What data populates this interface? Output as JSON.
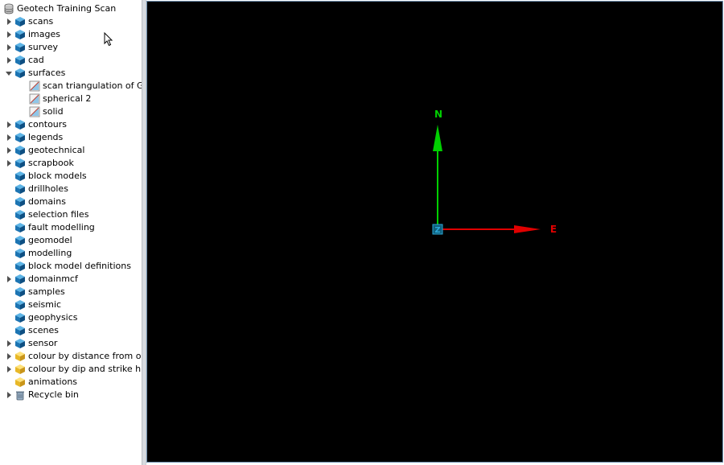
{
  "tree": {
    "root_label": "Geotech Training Scan",
    "items": [
      {
        "label": "scans",
        "icon": "blue-cube-icon",
        "arrow": "collapsed",
        "level": 0
      },
      {
        "label": "images",
        "icon": "blue-cube-icon",
        "arrow": "collapsed",
        "level": 0
      },
      {
        "label": "survey",
        "icon": "blue-cube-icon",
        "arrow": "collapsed",
        "level": 0
      },
      {
        "label": "cad",
        "icon": "blue-cube-icon",
        "arrow": "collapsed",
        "level": 0
      },
      {
        "label": "surfaces",
        "icon": "blue-cube-icon",
        "arrow": "expanded",
        "level": 0
      },
      {
        "label": "scan triangulation of G...",
        "icon": "surface-icon",
        "arrow": "none",
        "level": 1
      },
      {
        "label": "spherical 2",
        "icon": "surface-icon",
        "arrow": "none",
        "level": 1
      },
      {
        "label": "solid",
        "icon": "surface-icon",
        "arrow": "none",
        "level": 1
      },
      {
        "label": "contours",
        "icon": "blue-cube-icon",
        "arrow": "collapsed",
        "level": 0
      },
      {
        "label": "legends",
        "icon": "blue-cube-icon",
        "arrow": "collapsed",
        "level": 0
      },
      {
        "label": "geotechnical",
        "icon": "blue-cube-icon",
        "arrow": "collapsed",
        "level": 0
      },
      {
        "label": "scrapbook",
        "icon": "blue-cube-icon",
        "arrow": "collapsed",
        "level": 0
      },
      {
        "label": "block models",
        "icon": "blue-cube-icon",
        "arrow": "none",
        "level": 0
      },
      {
        "label": "drillholes",
        "icon": "blue-cube-icon",
        "arrow": "none",
        "level": 0
      },
      {
        "label": "domains",
        "icon": "blue-cube-icon",
        "arrow": "none",
        "level": 0
      },
      {
        "label": "selection files",
        "icon": "blue-cube-icon",
        "arrow": "none",
        "level": 0
      },
      {
        "label": "fault modelling",
        "icon": "blue-cube-icon",
        "arrow": "none",
        "level": 0
      },
      {
        "label": "geomodel",
        "icon": "blue-cube-icon",
        "arrow": "none",
        "level": 0
      },
      {
        "label": "modelling",
        "icon": "blue-cube-icon",
        "arrow": "none",
        "level": 0
      },
      {
        "label": "block model definitions",
        "icon": "blue-cube-icon",
        "arrow": "none",
        "level": 0
      },
      {
        "label": "domainmcf",
        "icon": "blue-cube-icon",
        "arrow": "collapsed",
        "level": 0
      },
      {
        "label": "samples",
        "icon": "blue-cube-icon",
        "arrow": "none",
        "level": 0
      },
      {
        "label": "seismic",
        "icon": "blue-cube-icon",
        "arrow": "none",
        "level": 0
      },
      {
        "label": "geophysics",
        "icon": "blue-cube-icon",
        "arrow": "none",
        "level": 0
      },
      {
        "label": "scenes",
        "icon": "blue-cube-icon",
        "arrow": "none",
        "level": 0
      },
      {
        "label": "sensor",
        "icon": "blue-cube-icon",
        "arrow": "collapsed",
        "level": 0
      },
      {
        "label": "colour by distance from o...",
        "icon": "yellow-cube-icon",
        "arrow": "collapsed",
        "level": 0
      },
      {
        "label": "colour by dip and strike hi...",
        "icon": "yellow-cube-icon",
        "arrow": "collapsed",
        "level": 0
      },
      {
        "label": "animations",
        "icon": "yellow-cube-icon",
        "arrow": "none",
        "level": 0
      },
      {
        "label": "Recycle bin",
        "icon": "recycle-bin-icon",
        "arrow": "collapsed",
        "level": 0
      }
    ]
  },
  "viewport": {
    "background": "#000000",
    "axes": {
      "north_label": "N",
      "east_label": "E",
      "origin_label": "Z",
      "north_color": "#00d000",
      "east_color": "#e00000",
      "origin_color": "#2aa7d6"
    }
  }
}
